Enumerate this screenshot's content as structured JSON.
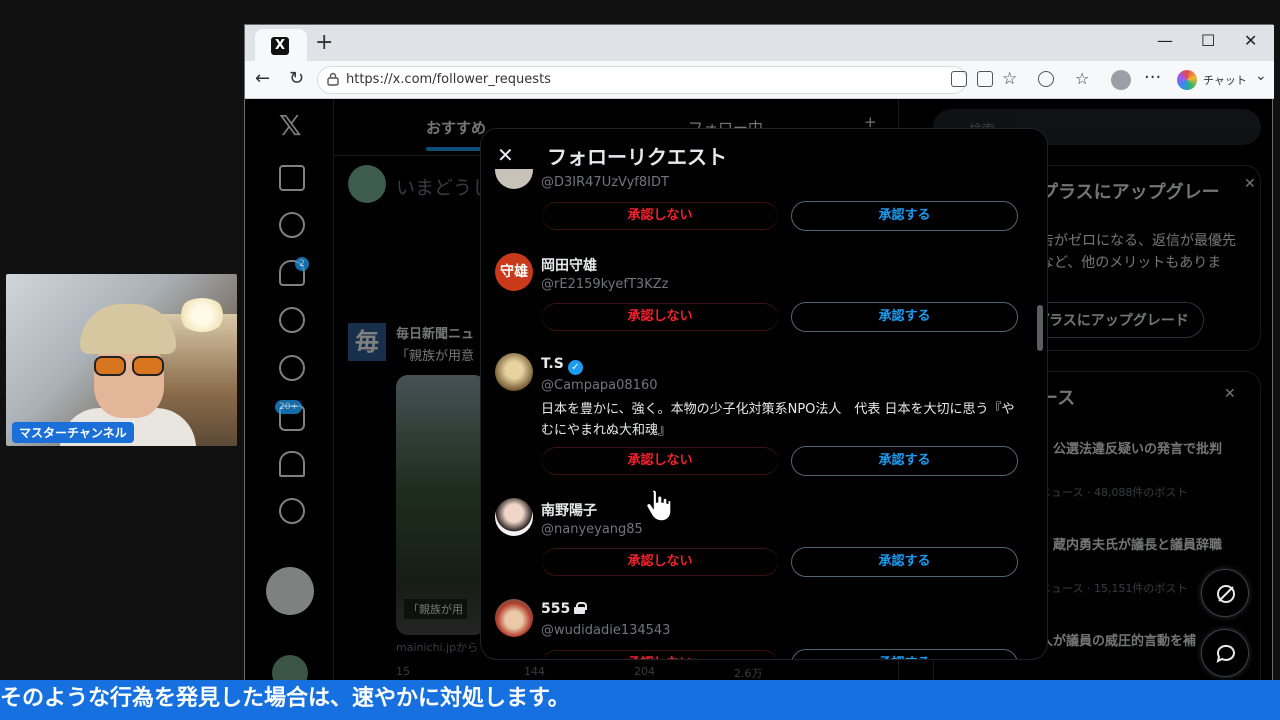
{
  "webcam": {
    "label": "マスターチャンネル"
  },
  "browser": {
    "tab_icon": "X",
    "new_tab": "+",
    "url": "https://x.com/follower_requests",
    "chat_label": "チャット",
    "window_controls": {
      "minimize": "—",
      "maximize": "☐",
      "close": "✕"
    }
  },
  "x": {
    "logo": "𝕏",
    "nav_badges": {
      "notifications": "2",
      "communities": "20+"
    },
    "timeline": {
      "tabs": [
        "おすすめ",
        "フォロー中"
      ],
      "add_tab": "+",
      "compose_placeholder": "いまどうし",
      "post": {
        "logo": "毎",
        "author": "毎日新聞ニュ",
        "text": "「親族が用意",
        "caption": "「親族が用",
        "source": "mainichi.jpから",
        "stats": {
          "replies": "15",
          "reposts": "144",
          "likes": "204",
          "views": "2.6万"
        }
      }
    },
    "right": {
      "search_placeholder": "検索",
      "premium": {
        "title": "プラスにアップグレー",
        "text1": "告がゼロになる、返信が最優先",
        "text2": "など、他のメリットもありま",
        "button": "プラスにアップグレード",
        "close": "✕"
      },
      "news": {
        "title": "ース",
        "close": "✕",
        "items": [
          {
            "title": "、公選法違反疑いの発言で批判",
            "meta": "ニュース · 48,088件のポスト"
          },
          {
            "title": "・蔵内勇夫氏が議長と議員辞職",
            "meta": "ニュース · 15,151件のポスト"
          },
          {
            "title": "人が議員の威圧的言動を補",
            "meta": ""
          }
        ]
      }
    },
    "modal": {
      "close": "✕",
      "title": "フォローリクエスト",
      "decline_label": "承認しない",
      "accept_label": "承認する",
      "requests": [
        {
          "name": "",
          "handle": "@D3IR47UzVyf8IDT",
          "bio": "",
          "verified": false,
          "locked": false
        },
        {
          "name": "岡田守雄",
          "handle": "@rE2159kyefT3KZz",
          "bio": "",
          "verified": false,
          "locked": false,
          "avatar_text": "守雄"
        },
        {
          "name": "T.S",
          "handle": "@Campapa08160",
          "bio": "日本を豊かに、強く。本物の少子化対策系NPO法人　代表 日本を大切に思う『やむにやまれぬ大和魂』",
          "verified": true,
          "locked": false
        },
        {
          "name": "南野陽子",
          "handle": "@nanyeyang85",
          "bio": "",
          "verified": false,
          "locked": false
        },
        {
          "name": "555",
          "handle": "@wudidadie134543",
          "bio": "",
          "verified": false,
          "locked": true
        }
      ]
    }
  },
  "subtitle": "そのような行為を発見した場合は、速やかに対処します。",
  "colors": {
    "accent": "#1d9bf0",
    "decline": "#f4212e",
    "subtitle_bg": "#1670e0"
  }
}
